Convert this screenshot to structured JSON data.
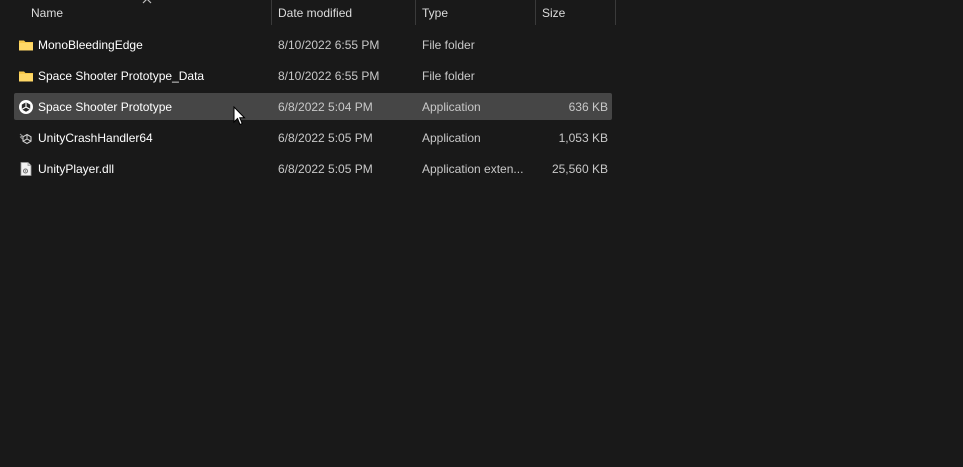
{
  "header": {
    "columns": [
      {
        "label": "Name"
      },
      {
        "label": "Date modified"
      },
      {
        "label": "Type"
      },
      {
        "label": "Size"
      }
    ],
    "sort_column": "Name",
    "sort_direction": "ascending"
  },
  "files": [
    {
      "name": "MonoBleedingEdge",
      "date": "8/10/2022 6:55 PM",
      "type": "File folder",
      "size": "",
      "icon": "folder-icon",
      "selected": false
    },
    {
      "name": "Space Shooter Prototype_Data",
      "date": "8/10/2022 6:55 PM",
      "type": "File folder",
      "size": "",
      "icon": "folder-icon",
      "selected": false
    },
    {
      "name": "Space Shooter Prototype",
      "date": "6/8/2022 5:04 PM",
      "type": "Application",
      "size": "636 KB",
      "icon": "unity-app-icon",
      "selected": true
    },
    {
      "name": "UnityCrashHandler64",
      "date": "6/8/2022 5:05 PM",
      "type": "Application",
      "size": "1,053 KB",
      "icon": "unity-crash-handler-icon",
      "selected": false
    },
    {
      "name": "UnityPlayer.dll",
      "date": "6/8/2022 5:05 PM",
      "type": "Application exten...",
      "size": "25,560 KB",
      "icon": "dll-file-icon",
      "selected": false
    }
  ],
  "colors": {
    "background": "#191919",
    "selection": "#464646",
    "folder": "#f8c94a",
    "text_primary": "#ffffff",
    "text_secondary": "#c8c8c8"
  }
}
